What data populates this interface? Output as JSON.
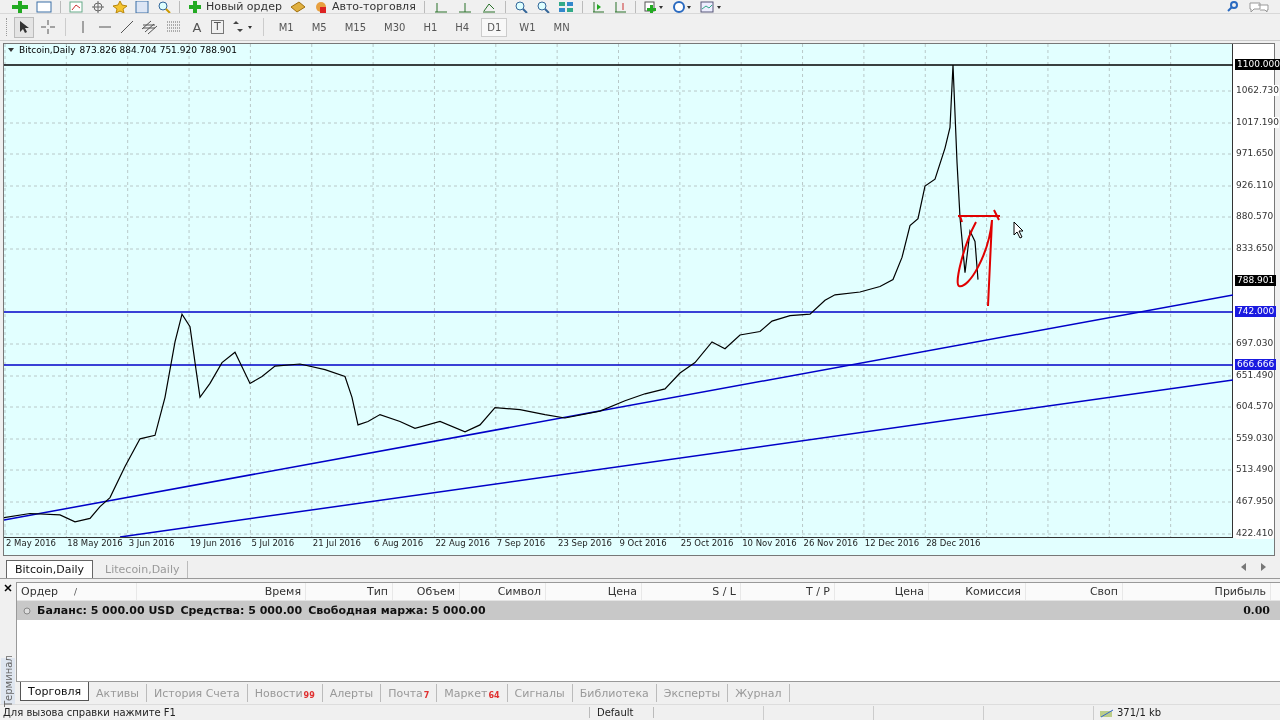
{
  "toolbar": {
    "order_button": "Новый ордер",
    "autotrading_button": "Авто-торговля",
    "text_tool": "A",
    "label_tool": "T",
    "timeframes": [
      {
        "label": "M1",
        "selected": false
      },
      {
        "label": "M5",
        "selected": false
      },
      {
        "label": "M15",
        "selected": false
      },
      {
        "label": "M30",
        "selected": false
      },
      {
        "label": "H1",
        "selected": false
      },
      {
        "label": "H4",
        "selected": false
      },
      {
        "label": "D1",
        "selected": true
      },
      {
        "label": "W1",
        "selected": false
      },
      {
        "label": "MN",
        "selected": false
      }
    ]
  },
  "chart": {
    "symbol": "Bitcoin,Daily",
    "ohlc": "873.826 884.704 751.920 788.901",
    "price_ticks": [
      "1062.730",
      "1017.190",
      "971.650",
      "926.110",
      "880.570",
      "833.650",
      "697.030",
      "651.490",
      "604.570",
      "559.030",
      "513.490",
      "467.950",
      "422.410"
    ],
    "price_tags": [
      {
        "label": "1100.000",
        "kind": "line"
      },
      {
        "label": "788.901",
        "kind": "current"
      },
      {
        "label": "742.000",
        "kind": "level"
      },
      {
        "label": "666.666",
        "kind": "level"
      }
    ],
    "date_labels": [
      "2 May 2016",
      "18 May 2016",
      "3 Jun 2016",
      "19 Jun 2016",
      "5 Jul 2016",
      "21 Jul 2016",
      "6 Aug 2016",
      "22 Aug 2016",
      "7 Sep 2016",
      "23 Sep 2016",
      "9 Oct 2016",
      "25 Oct 2016",
      "10 Nov 2016",
      "26 Nov 2016",
      "12 Dec 2016",
      "28 Dec 2016"
    ]
  },
  "chart_tabs": [
    {
      "label": "Bitcoin,Daily",
      "selected": true
    },
    {
      "label": "Litecoin,Daily",
      "selected": false
    }
  ],
  "terminal": {
    "side_label": "Терминал",
    "sort_mark": "/",
    "columns": [
      "Ордер",
      "Время",
      "Тип",
      "Объем",
      "Символ",
      "Цена",
      "S / L",
      "T / P",
      "Цена",
      "Комиссия",
      "Своп",
      "Прибыль"
    ],
    "summary": [
      "Баланс: 5 000.00 USD",
      "Средства: 5 000.00",
      "Свободная маржа: 5 000.00"
    ],
    "profit": "0.00",
    "tabs": [
      {
        "label": "Торговля",
        "selected": true
      },
      {
        "label": "Активы",
        "selected": false
      },
      {
        "label": "История Счета",
        "selected": false
      },
      {
        "label": "Новости",
        "badge": "99",
        "selected": false
      },
      {
        "label": "Алерты",
        "selected": false
      },
      {
        "label": "Почта",
        "badge": "7",
        "selected": false
      },
      {
        "label": "Маркет",
        "badge": "64",
        "selected": false
      },
      {
        "label": "Сигналы",
        "selected": false
      },
      {
        "label": "Библиотека",
        "selected": false
      },
      {
        "label": "Эксперты",
        "selected": false
      },
      {
        "label": "Журнал",
        "selected": false
      }
    ]
  },
  "status_bar": {
    "help": "Для вызова справки нажмите F1",
    "profile": "Default",
    "traffic": "371/1 kb"
  }
}
